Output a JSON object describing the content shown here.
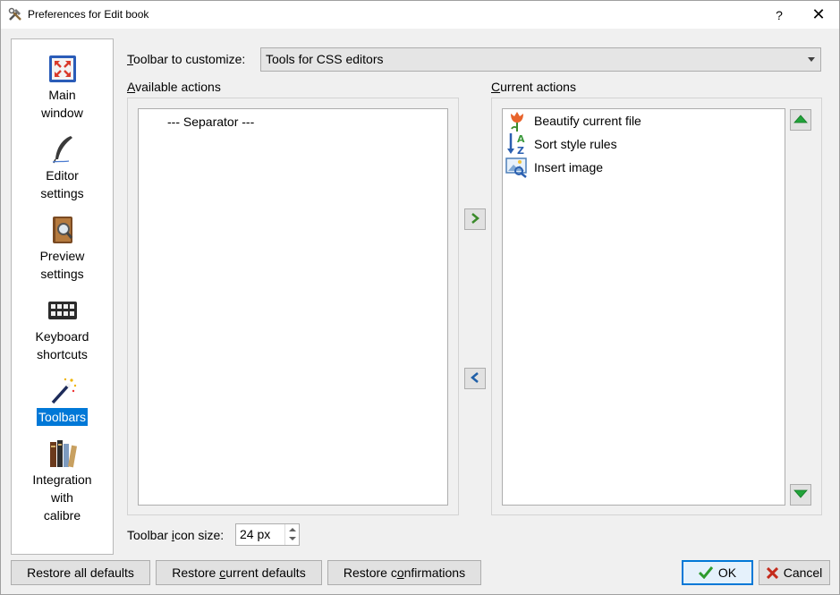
{
  "window": {
    "title": "Preferences for Edit book",
    "help_label": "?",
    "close_label": "✕"
  },
  "sidebar": {
    "items": [
      {
        "label_line1": "Main",
        "label_line2": "window",
        "icon": "main-window-icon"
      },
      {
        "label_line1": "Editor",
        "label_line2": "settings",
        "icon": "quill-icon"
      },
      {
        "label_line1": "Preview",
        "label_line2": "settings",
        "icon": "preview-book-icon"
      },
      {
        "label_line1": "Keyboard",
        "label_line2": "shortcuts",
        "icon": "keyboard-icon"
      },
      {
        "label_line1": "Toolbars",
        "label_line2": "",
        "icon": "magic-wand-icon",
        "active": true
      },
      {
        "label_line1": "Integration",
        "label_line2": "with",
        "label_line3": "calibre",
        "icon": "books-icon"
      }
    ]
  },
  "toolbar_select": {
    "label_prefix": "T",
    "label_rest": "oolbar to customize:",
    "value": "Tools for CSS editors"
  },
  "available": {
    "header_prefix": "A",
    "header_rest": "vailable actions",
    "items": [
      "--- Separator ---"
    ]
  },
  "current": {
    "header_prefix": "C",
    "header_rest": "urrent actions",
    "items": [
      {
        "label": "Beautify current file",
        "icon": "tulip-icon"
      },
      {
        "label": "Sort style rules",
        "icon": "sort-az-icon"
      },
      {
        "label": "Insert image",
        "icon": "insert-image-icon"
      }
    ]
  },
  "icon_size": {
    "label_a": "Toolbar ",
    "label_u": "i",
    "label_b": "con size:",
    "value": "24 px"
  },
  "buttons": {
    "restore_all": "Restore all defaults",
    "restore_current_a": "Restore ",
    "restore_current_u": "c",
    "restore_current_b": "urrent defaults",
    "restore_conf_a": "Restore c",
    "restore_conf_u": "o",
    "restore_conf_b": "nfirmations",
    "ok": "OK",
    "cancel": "Cancel"
  },
  "colors": {
    "accent": "#0078d7",
    "ok_icon": "#2e9b2e",
    "cancel_icon": "#c42b1c"
  }
}
